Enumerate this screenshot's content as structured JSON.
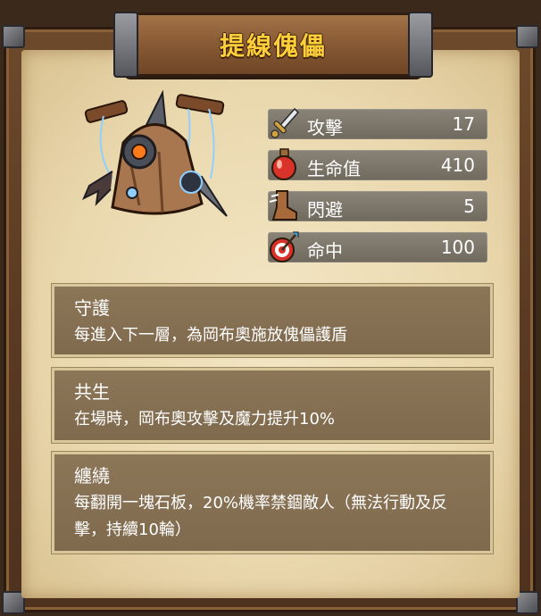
{
  "title": "提線傀儡",
  "stats": [
    {
      "icon": "sword-icon",
      "label": "攻擊",
      "value": "17"
    },
    {
      "icon": "potion-icon",
      "label": "生命值",
      "value": "410"
    },
    {
      "icon": "boot-icon",
      "label": "閃避",
      "value": "5"
    },
    {
      "icon": "target-icon",
      "label": "命中",
      "value": "100"
    }
  ],
  "skills": [
    {
      "name": "守護",
      "desc": "每進入下一層，為岡布奧施放傀儡護盾"
    },
    {
      "name": "共生",
      "desc": "在場時，岡布奧攻擊及魔力提升10%"
    },
    {
      "name": "纏繞",
      "desc": "每翻開一塊石板，20%機率禁錮敵人（無法行動及反擊，持續10輪）"
    }
  ],
  "colors": {
    "title": "#ffcf3a",
    "stat_bar": "#7d776b",
    "skill_card": "#85704f",
    "parchment": "#ead8ae"
  }
}
